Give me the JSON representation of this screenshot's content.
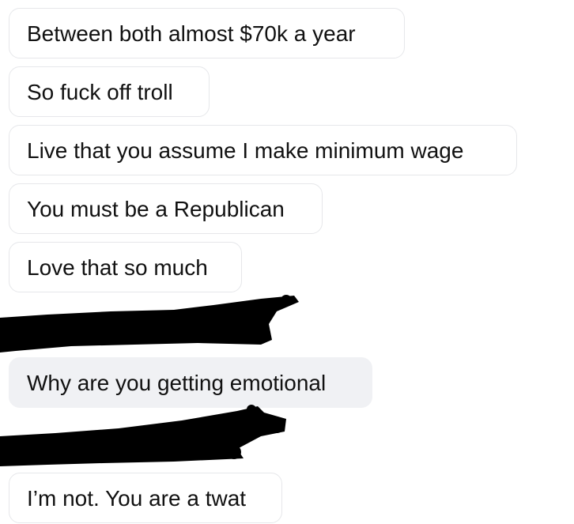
{
  "messages": [
    {
      "text": "Between both almost $70k a year",
      "style": "outlined"
    },
    {
      "text": "So fuck off troll",
      "style": "outlined"
    },
    {
      "text": "Live that you assume I make minimum wage",
      "style": "outlined"
    },
    {
      "text": "You must be a Republican",
      "style": "outlined"
    },
    {
      "text": "Love that so much",
      "style": "outlined"
    },
    {
      "text": "Why are you getting emotional",
      "style": "filled"
    },
    {
      "text": "I’m not. You are a twat",
      "style": "outlined"
    }
  ],
  "redactions": [
    {
      "description": "black scribble redaction"
    },
    {
      "description": "black scribble redaction"
    }
  ],
  "colors": {
    "outlined_bubble_bg": "#ffffff",
    "outlined_bubble_border": "#e6e7ea",
    "filled_bubble_bg": "#f0f1f4",
    "text": "#111111",
    "redaction": "#000000"
  }
}
